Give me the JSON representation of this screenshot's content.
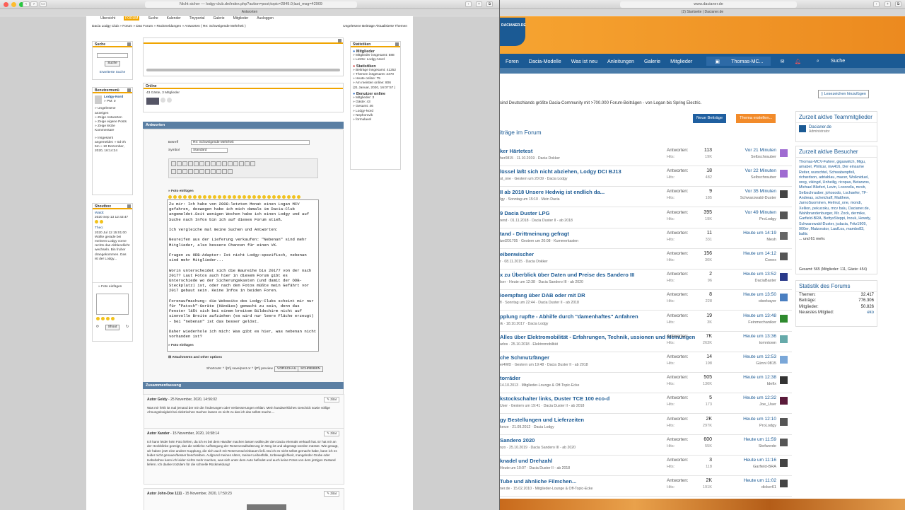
{
  "left_window": {
    "url": "Nicht sicher — lodgy-club.de/index.php?action=post;topic=2849.0;last_msg=42909",
    "tab": "Antworten",
    "topnav": [
      "Übersicht",
      "FORUM",
      "Suche",
      "Kalender",
      "Tinyportal",
      "Galerie",
      "Mitglieder",
      "Ausloggen"
    ],
    "breadcrumb": "Dacia Lodgy Club » Forum » Das Forum » Rückmeldungen » Antworten ( Re: Schweigende Mehrheit )",
    "breadcrumb_right": "Ungelesene Beiträge   Aktualisierte Themen",
    "search": {
      "title": "Suche",
      "button": "Suche",
      "advanced": "Erweiterte Suche"
    },
    "usermenu": {
      "title": "Benutzermenü",
      "username": "Lodgy-Nord",
      "pm": "» PM: 0",
      "links": [
        "» Ungelesene anzeigen",
        "» Zeige Antworten",
        "» Zeige eigene Posts",
        "» Zeige letzte Kommentare"
      ],
      "registered": "» Insgesamt angemeldet: » 0d 0h 5m » 10 Dezember, 2020, 16:14:24"
    },
    "shoutbox": {
      "title": "Shoutbox",
      "entries": [
        {
          "user": "Waldi:",
          "date": "2020 Sep 13 12:43:47"
        },
        {
          "user": "Theo:",
          "date": "2020 Jul 12 15:01:00",
          "text": "Wollte gerade bei meinem Lodgy vorne rechts das Abblendlicht wechseln. Bin fruher drangekommen. Das ist der Lodgy..."
        }
      ],
      "insert": "» Foto einfügen",
      "button": "Shout"
    },
    "online": {
      "title": "Online",
      "text": "43 Gäste, 3 Mitglieder"
    },
    "stats": {
      "title": "Statistiken",
      "members_head": "Mitglieder",
      "members": [
        "» Mitglieder insgesamt: 588",
        "» Letzte: Lodgy-Nord"
      ],
      "stats_head": "Statistiken",
      "stats": [
        "» Beiträge insgesamt: 41252",
        "» Themen insgesamt: 2470",
        "» Heute online: 75",
        "» Am meisten online: 806",
        "(21 Januar, 2020, 16:07:57 )"
      ],
      "online_head": "Benutzer online",
      "online": [
        "» Mitglieder: 3",
        "» Gäste: 43",
        "» Gesamt: 46",
        "» Lodgy-Nord",
        "» Nephorovik",
        "» formulavel"
      ]
    },
    "reply": {
      "bar": "Antworten",
      "subject_label": "Betreff",
      "subject_value": "Re: Schweigende Mehrheit",
      "symbol_label": "Symbol",
      "symbol_value": "Standard",
      "foto_insert": "» Foto einfügen",
      "body": "Zu mir: Ich habe von 2008-letzten Monat einen Logan MCV gefahren, deswegen habe ich mich damals im Dacia-Club angemeldet.Seit wenigen Wochen habe ich einen Lodgy und auf Suche nach Infos bin ich auf dieses Forum stieß.\n\nIch vergleiche mal meine Suchen und Antworten:\n\nNeureifen aus der Lieferung verkaufen: \"Nebenan\" sind mehr Mitglieder, also bessere Chancen für einen VK.\n\nFragen zu ODB-Adapter: Ist nicht Lodgy-spezifisch, nebenan sind mehr Mitglieder...\n\nWorin unterscheidet sich die Baureihe bis 20177 von der nach 2017? Laut Fotos auch hier in diesem Forum gibt es Unterschiede wo der Sicherungskasten (und damit der ODB-Steckplatz) ist, oder nach den Fotos müßte mein Gefährt vor 2017 gebaut sein. Keine Infos in beiden Foren.\n\nForenaufmachung: die Webseite des Lodgy-Clubs scheint mir nur für \"Patsch\"-Geräte (Händies) gemacht zu sein, denn das Fenster läßt sich bei einem breitem Bildschirm nicht auf sinnvolle Breite aufziehen (es wird nur leere Fläche erzeugt) - bei \"nebenan\" ist das besser gelöst.\n\nDaher wiederhole ich mich: Was gibt es hier, was nebenan nicht vorhanden ist?",
      "foto_insert2": "» Foto einfügen",
      "attachments": "Attachments and other options",
      "shortcuts": "Shortcuts: ^ \\[S\\] save/post or ^ \\[P\\] preview",
      "preview_btn": "VORSCHAU",
      "send_btn": "SCHREIBEN"
    },
    "summary": {
      "bar": "Zusammenfassung",
      "quote": "Zitat",
      "posts": [
        {
          "author": "Autor Geldy",
          "date": " - 25 November, 2020, 14:56:02",
          "text": "Was mir fehlt ist mal jemand der mir die Änderungen oder Verbesserungen erklärt. Mein handwerkliches Geschick sowie völlige Ahnungslosigkeit bei elektrischen Sachen lassen es nicht zu das ich das selbst mache...."
        },
        {
          "author": "Autor Xander",
          "date": " - 15 November, 2020, 16:58:14",
          "text": "Ich kann leider kein Foto liefern, da ich es bei dem Händler machen lassen wollte,der den Dacia ehemals verkauft hat. Er hat mir an der Heckblinke gezeigt, das die seitliche Aufhängung der Reserveradhalterung im Weg ist und abgesägt werden müsste. Wie gesagt, wir haben jetzt eine andere Kupplung, die sich auch mit Reserverad einbauen ließ. Da ich es nicht selbst gemacht habe, kann ich es leider nicht genauer/besser beschreiben. Aufgrund meines Alters, meiner Leibesfülle, Unbeweglichkeit, mangelnder Grube oder Hebebühne kann ich leider nichts mehr machen, was sich unter dem Auto befindet und auch keine Fotos von dem jetzigen Zustand liefern. Ich danke trotzdem für die schnelle Rückmeldung!"
        },
        {
          "author": "Autor John-Doe 1111",
          "date": " - 15 November, 2020, 17:50:23",
          "text": ""
        }
      ]
    }
  },
  "right_window": {
    "url": "www.dacianer.de",
    "tab": "(2) Startseite | Dacianer.de",
    "logo": "DACIANER.DE",
    "nav": [
      "Foren",
      "Dacia-Modelle",
      "Was ist neu",
      "Anleitungen",
      "Galerie",
      "Mitglieder"
    ],
    "user": "Thomas-MC...",
    "search": "Suche",
    "bookmark": "Lesezeichen hinzufügen",
    "intro": "sind Deutschlands größte Dacia-Community mit >700.000 Forum-Beiträgen - von Logan bis Spring Electric.",
    "btn_new": "Neue Beiträge",
    "btn_thread": "Thema erstellen...",
    "section": "iträge im Forum",
    "answers_label": "Antworten:",
    "views_label": "Hits:",
    "threads": [
      {
        "title": "ker Härtetest",
        "sub": "her0815 · 11.10.2019 · Dacia Dokker",
        "a": "113",
        "v": "19K",
        "d": "Vor 21 Minuten",
        "u": "Selbschrauber",
        "c": "#9f6bd1"
      },
      {
        "title": "lüssel läßt sich nicht abziehen, Lodgy DCI BJ13",
        "sub": "ut_one · Gestern um 20:09 · Dacia Lodgy",
        "a": "18",
        "v": "482",
        "d": "Vor 22 Minuten",
        "u": "Selbschrauber",
        "c": "#9f6bd1"
      },
      {
        "title": "II ab 2018 Unsere Hedwig ist endlich da...",
        "sub": "Igy · Sonntag um 15:10 · Mein Dacia",
        "a": "9",
        "v": "185",
        "d": "Vor 35 Minuten",
        "u": "Schwarzwald-Duster",
        "c": "#444"
      },
      {
        "title": "9 Dacia Duster LPG",
        "sub": "rend · 01.11.2018 · Dacia Duster II - ab 2018",
        "a": "395",
        "v": "19K",
        "d": "Vor 49 Minuten",
        "u": "ProLodgy",
        "c": "#555"
      },
      {
        "title": "tand - Drittmeinung gefragt",
        "sub": "tzel201705 · Gestern um 20:08 · Kummerkasten",
        "a": "11",
        "v": "331",
        "d": "Heute um 14:19",
        "u": "Mesh",
        "c": "#666"
      },
      {
        "title": "eibenwischer",
        "sub": "r · 08.11.2015 · Dacia Dokker",
        "a": "156",
        "v": "30K",
        "d": "Heute um 14:12",
        "u": "Conex",
        "c": "#555"
      },
      {
        "title": "x zu Überblick über Daten und Preise des Sandero III",
        "sub": "lser · Heute um 12:38 · Dacia Sandero III - ab 2020",
        "a": "2",
        "v": "96",
        "d": "Heute um 13:52",
        "u": "DaciaBaster",
        "c": "#2a3a8a"
      },
      {
        "title": "ioempfang über DAB oder mit DR",
        "sub": "fl · Sonntag um 22:44 · Dacia Duster II - ab 2018",
        "a": "8",
        "v": "228",
        "d": "Heute um 13:50",
        "u": "oberbayer",
        "c": "#4a7fc1"
      },
      {
        "title": "pplung rupfte - Abhilfe durch \"damenhaftes\" Anfahren",
        "sub": "rk · 18.10.2017 · Dacia Lodgy",
        "a": "19",
        "v": "3K",
        "d": "Heute um 13:48",
        "u": "Feinmechaniker",
        "c": "#2e8a2e"
      },
      {
        "title": "Alles über Elektromobilität - Erfahrungen, Technik, ussionen und Meinungen",
        "sub": "arlos · 25.10.2018 · Elektromobilität",
        "a": "7K",
        "v": "263K",
        "d": "Heute um 13:36",
        "u": "tomntown",
        "c": "#6aa"
      },
      {
        "title": "che Schmutzfänger",
        "sub": "er4WD · Gestern um 19:48 · Dacia Duster II - ab 2018",
        "a": "14",
        "v": "198",
        "d": "Heute um 12:53",
        "u": "Günni 0815",
        "c": "#7aa7d8"
      },
      {
        "title": "torräder",
        "sub": "14.10.2013 · Mitglieder-Lounge & Off-Topic-Ecke",
        "a": "505",
        "v": "136K",
        "d": "Heute um 12:38",
        "u": "Idefix",
        "c": "#333"
      },
      {
        "title": "kstockschalter links, Duster TCE 100 eco-d",
        "sub": "User · Gestern um 19:41 · Dacia Duster II - ab 2018",
        "a": "5",
        "v": "173",
        "d": "Heute um 12:32",
        "u": "Joe_User",
        "c": "#5a1a3a"
      },
      {
        "title": "gy Bestellungen und Lieferzeiten",
        "sub": "kerze · 21.09.2012 · Dacia Lodgy",
        "a": "2K",
        "v": "297K",
        "d": "Heute um 12:10",
        "u": "ProLodgy",
        "c": "#555"
      },
      {
        "title": "Sandero 2020",
        "sub": "nzo · 25.10.2019 · Dacia Sandero III - ab 2020",
        "a": "600",
        "v": "55K",
        "d": "Heute um 11:59",
        "u": "Stefanvde",
        "c": "#555"
      },
      {
        "title": "knadel und Drehzahl",
        "sub": "Heute um 10:07 · Dacia Duster II - ab 2018",
        "a": "3",
        "v": "118",
        "d": "Heute um 11:16",
        "u": "Garfield-BRA",
        "c": "#444"
      },
      {
        "title": "Tube und ähnliche Filmchen...",
        "sub": "ner.de · 15.02.2010 · Mitglieder-Lounge & Off-Topic-Ecke",
        "a": "2K",
        "v": "191K",
        "d": "Heute um 11:02",
        "u": "dicker61",
        "c": "#444"
      }
    ],
    "team": {
      "title": "Zurzeit aktive Teammitglieder",
      "name": "Dacianer.de",
      "role": "Administrator"
    },
    "visitors": {
      "title": "Zurzeit aktive Besucher",
      "list": "Thomas-MCV-Fahrer, gigaswitch, Migu, amabel, Philicar, mw416, Der einsame Reiter, wurschtel, Schwabenpfeil, richardson, adriablau, macer, Wolkniduel, oreg, vikingd, Unheilig, ricopas, Betanzos, Michael Bliefert, Levin, Locorella, mcvb, Selbschrauber, johosodo, t.schaefer, TF-Andreas, scheichaff, Matthew, JarnoSuominen, Helmut_one, mondi, Xellion, pekucoku, mcv balu, Dacianer.de, Wahlbrandenburger, Mr. Zock, dermike, Garfield-BRA, BettysSteppi, Inouk, Howdy, Schwarzwald-Duster, jcdacia, Fritz1909, 900er, Matzorator, LaufLos, mambo83, baltic",
      "more": "... und 61 mehr.",
      "total": "Gesamt: 565 (Mitglieder: 111, Gäste: 454)"
    },
    "forum_stats": {
      "title": "Statistik des Forums",
      "rows": [
        {
          "k": "Themen:",
          "v": "32.417"
        },
        {
          "k": "Beiträge:",
          "v": "776.306"
        },
        {
          "k": "Mitglieder:",
          "v": "50.826"
        },
        {
          "k": "Neuestes Mitglied:",
          "v": "eko"
        }
      ]
    }
  }
}
